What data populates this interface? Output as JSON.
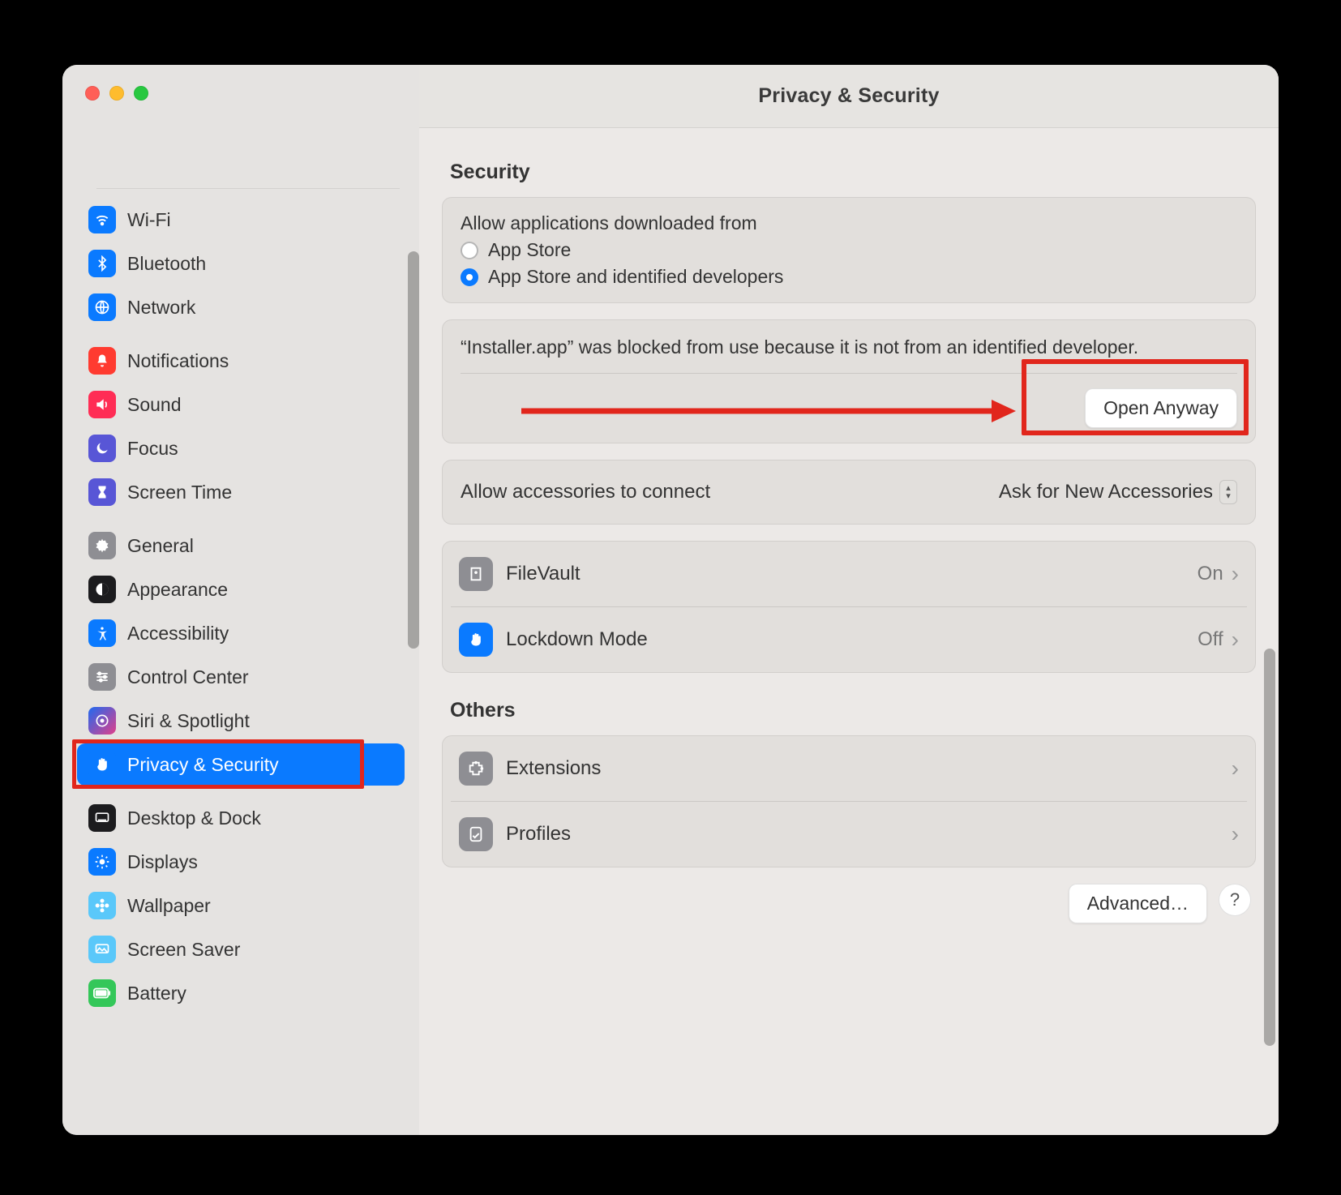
{
  "window_title": "Privacy & Security",
  "sidebar": {
    "groups": [
      [
        {
          "label": "Wi-Fi",
          "icon": "wifi",
          "bg": "#0a7aff"
        },
        {
          "label": "Bluetooth",
          "icon": "bluetooth",
          "bg": "#0a7aff"
        },
        {
          "label": "Network",
          "icon": "globe",
          "bg": "#0a7aff"
        }
      ],
      [
        {
          "label": "Notifications",
          "icon": "bell",
          "bg": "#ff3b30"
        },
        {
          "label": "Sound",
          "icon": "speaker",
          "bg": "#ff2d55"
        },
        {
          "label": "Focus",
          "icon": "moon",
          "bg": "#5856d6"
        },
        {
          "label": "Screen Time",
          "icon": "hourglass",
          "bg": "#5856d6"
        }
      ],
      [
        {
          "label": "General",
          "icon": "gear",
          "bg": "#8e8e93"
        },
        {
          "label": "Appearance",
          "icon": "contrast",
          "bg": "#1c1c1e"
        },
        {
          "label": "Accessibility",
          "icon": "person",
          "bg": "#0a7aff"
        },
        {
          "label": "Control Center",
          "icon": "sliders",
          "bg": "#8e8e93"
        },
        {
          "label": "Siri & Spotlight",
          "icon": "siri",
          "bg": "linear-gradient(135deg,#1f6af0,#e13f8a)"
        },
        {
          "label": "Privacy & Security",
          "icon": "hand",
          "bg": "#0a7aff",
          "selected": true
        }
      ],
      [
        {
          "label": "Desktop & Dock",
          "icon": "dock",
          "bg": "#1c1c1e"
        },
        {
          "label": "Displays",
          "icon": "sun",
          "bg": "#0a7aff"
        },
        {
          "label": "Wallpaper",
          "icon": "flower",
          "bg": "#5ac8fa"
        },
        {
          "label": "Screen Saver",
          "icon": "screens",
          "bg": "#5ac8fa"
        },
        {
          "label": "Battery",
          "icon": "battery",
          "bg": "#34c759"
        }
      ]
    ]
  },
  "security": {
    "heading": "Security",
    "allow_label": "Allow applications downloaded from",
    "options": {
      "app_store": "App Store",
      "identified": "App Store and identified developers"
    },
    "blocked_msg": "“Installer.app” was blocked from use because it is not from an identified developer.",
    "open_anyway": "Open Anyway",
    "accessories_label": "Allow accessories to connect",
    "accessories_value": "Ask for New Accessories",
    "filevault": {
      "label": "FileVault",
      "value": "On"
    },
    "lockdown": {
      "label": "Lockdown Mode",
      "value": "Off"
    }
  },
  "others": {
    "heading": "Others",
    "extensions": "Extensions",
    "profiles": "Profiles"
  },
  "bottom": {
    "advanced": "Advanced…",
    "help": "?"
  },
  "icons": {
    "wifi": "◖",
    "bluetooth": "B",
    "globe": "●",
    "bell": "▲",
    "speaker": "▶",
    "moon": "☾",
    "hourglass": "⧗",
    "gear": "⚙",
    "contrast": "◑",
    "person": "♿",
    "sliders": "☰",
    "siri": "◉",
    "hand": "✋",
    "dock": "▤",
    "sun": "☀",
    "flower": "❁",
    "screens": "▣",
    "battery": "▬",
    "lock": "▢",
    "puzzle": "▦",
    "check": "✔"
  }
}
